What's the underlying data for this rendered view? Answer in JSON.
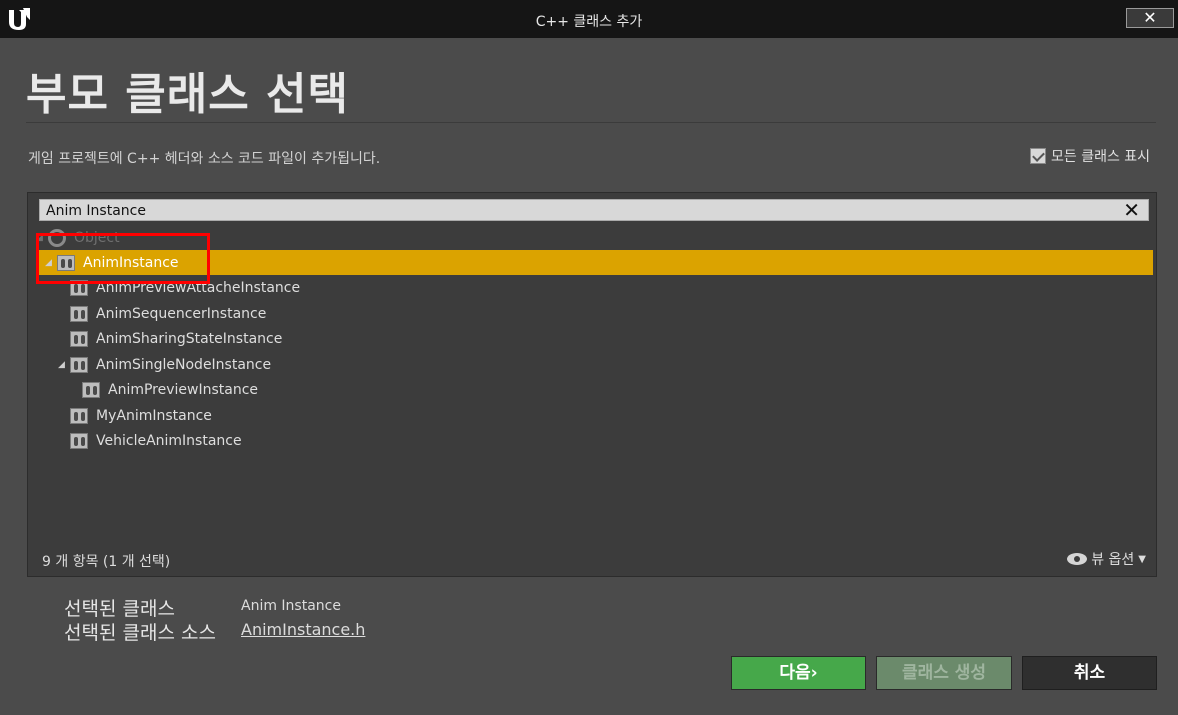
{
  "window": {
    "title": "C++ 클래스 추가",
    "close_label": "✕"
  },
  "header": {
    "heading": "부모 클래스 선택",
    "subtitle": "게임 프로젝트에 C++ 헤더와 소스 코드 파일이 추가됩니다."
  },
  "options": {
    "show_all_classes_label": "모든 클래스 표시",
    "show_all_classes_checked": true
  },
  "search": {
    "value": "Anim Instance"
  },
  "tree": {
    "items": [
      {
        "label": "Object",
        "depth": 0,
        "expanded": true,
        "icon": "object-icon",
        "state": "dim"
      },
      {
        "label": "AnimInstance",
        "depth": 1,
        "expanded": true,
        "icon": "class-icon",
        "state": "selected"
      },
      {
        "label": "AnimPreviewAttacheInstance",
        "depth": 2,
        "icon": "class-icon"
      },
      {
        "label": "AnimSequencerInstance",
        "depth": 2,
        "icon": "class-icon"
      },
      {
        "label": "AnimSharingStateInstance",
        "depth": 2,
        "icon": "class-icon"
      },
      {
        "label": "AnimSingleNodeInstance",
        "depth": 2,
        "expanded": true,
        "icon": "class-icon"
      },
      {
        "label": "AnimPreviewInstance",
        "depth": 3,
        "icon": "class-icon"
      },
      {
        "label": "MyAnimInstance",
        "depth": 2,
        "icon": "class-icon"
      },
      {
        "label": "VehicleAnimInstance",
        "depth": 2,
        "icon": "class-icon"
      }
    ]
  },
  "panel_footer": {
    "count_text": "9 개 항목 (1 개 선택)",
    "view_options_label": "뷰 옵션"
  },
  "selection": {
    "class_label": "선택된 클래스",
    "class_value": "Anim Instance",
    "source_label": "선택된 클래스 소스",
    "source_value": "AnimInstance.h"
  },
  "buttons": {
    "next": "다음",
    "next_suffix": "›",
    "create": "클래스 생성",
    "cancel": "취소"
  },
  "colors": {
    "selected_row": "#dba300",
    "highlight_box": "#ff0000",
    "next_button": "#46a84a"
  }
}
